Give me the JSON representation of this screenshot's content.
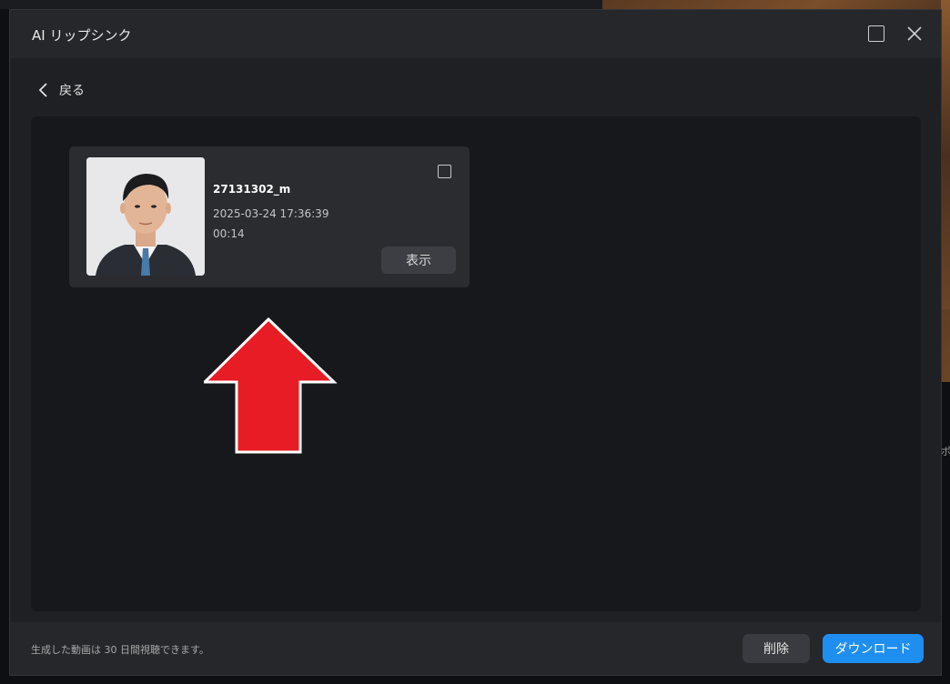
{
  "dialog": {
    "title": "AI リップシンク",
    "back_label": "戻る"
  },
  "video": {
    "name": "27131302_m",
    "created": "2025-03-24 17:36:39",
    "duration": "00:14",
    "view_label": "表示"
  },
  "footer": {
    "note": "生成した動画は 30 日間視聴できます。",
    "delete_label": "削除",
    "download_label": "ダウンロード"
  },
  "background": {
    "right_edge_text": "ポ"
  },
  "icons": {
    "maximize": "maximize-icon",
    "close": "close-icon",
    "back": "chevron-left-icon",
    "annotation": "up-arrow-annotation"
  },
  "colors": {
    "accent": "#1f8ef1",
    "annotation_arrow": "#e81c24"
  }
}
